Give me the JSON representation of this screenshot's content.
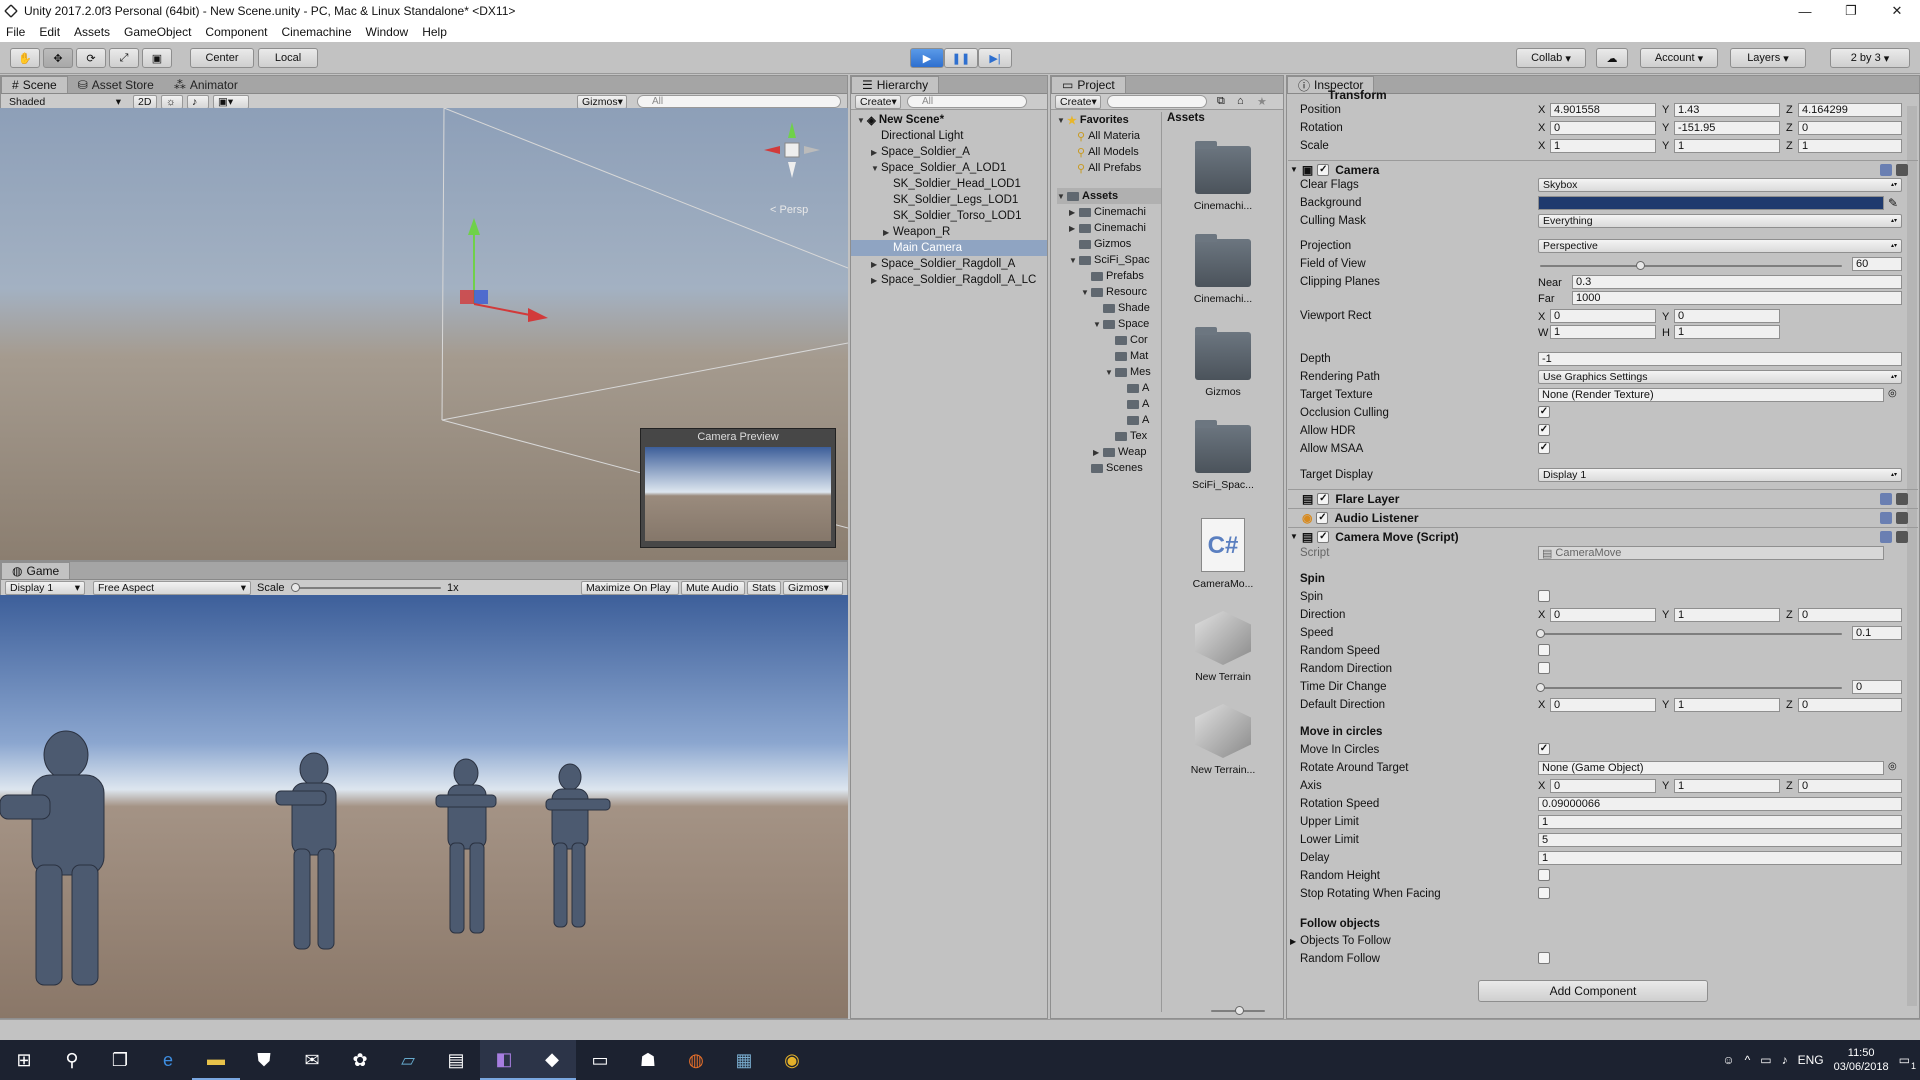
{
  "window": {
    "title": "Unity 2017.2.0f3 Personal (64bit) - New Scene.unity - PC, Mac & Linux Standalone* <DX11>",
    "controls": [
      "—",
      "❐",
      "✕"
    ]
  },
  "menu": [
    "File",
    "Edit",
    "Assets",
    "GameObject",
    "Component",
    "Cinemachine",
    "Window",
    "Help"
  ],
  "toolbar": {
    "pivot": "Center",
    "space": "Local",
    "collab": "Collab",
    "account": "Account",
    "layers": "Layers",
    "layout": "2 by 3"
  },
  "scene": {
    "tabs": [
      "Scene",
      "Asset Store",
      "Animator"
    ],
    "shading": "Shaded",
    "mode2d": "2D",
    "gizmos": "Gizmos",
    "search_placeholder": "All",
    "persp_label": "< Persp",
    "preview_title": "Camera Preview"
  },
  "game": {
    "tab": "Game",
    "display": "Display 1",
    "aspect": "Free Aspect",
    "scale_label": "Scale",
    "scale_value": "1x",
    "buttons": [
      "Maximize On Play",
      "Mute Audio",
      "Stats",
      "Gizmos"
    ]
  },
  "hierarchy": {
    "tab": "Hierarchy",
    "create": "Create",
    "search_placeholder": "All",
    "scene_name": "New Scene*",
    "items": [
      {
        "label": "Directional Light",
        "indent": 1,
        "arrow": ""
      },
      {
        "label": "Space_Soldier_A",
        "indent": 1,
        "arrow": "▶"
      },
      {
        "label": "Space_Soldier_A_LOD1",
        "indent": 1,
        "arrow": "▼"
      },
      {
        "label": "SK_Soldier_Head_LOD1",
        "indent": 2,
        "arrow": ""
      },
      {
        "label": "SK_Soldier_Legs_LOD1",
        "indent": 2,
        "arrow": ""
      },
      {
        "label": "SK_Soldier_Torso_LOD1",
        "indent": 2,
        "arrow": ""
      },
      {
        "label": "Weapon_R",
        "indent": 2,
        "arrow": "▶"
      },
      {
        "label": "Main Camera",
        "indent": 2,
        "arrow": "",
        "selected": true
      },
      {
        "label": "Space_Soldier_Ragdoll_A",
        "indent": 1,
        "arrow": "▶"
      },
      {
        "label": "Space_Soldier_Ragdoll_A_LC",
        "indent": 1,
        "arrow": "▶"
      }
    ]
  },
  "project": {
    "tab": "Project",
    "create": "Create",
    "favorites_label": "Favorites",
    "favorites": [
      "All Materia",
      "All Models",
      "All Prefabs"
    ],
    "assets_label": "Assets",
    "tree": [
      {
        "label": "Cinemachi",
        "indent": 1,
        "arrow": "▶"
      },
      {
        "label": "Cinemachi",
        "indent": 1,
        "arrow": "▶"
      },
      {
        "label": "Gizmos",
        "indent": 1,
        "arrow": ""
      },
      {
        "label": "SciFi_Spac",
        "indent": 1,
        "arrow": "▼"
      },
      {
        "label": "Prefabs",
        "indent": 2,
        "arrow": ""
      },
      {
        "label": "Resourc",
        "indent": 2,
        "arrow": "▼"
      },
      {
        "label": "Shade",
        "indent": 3,
        "arrow": ""
      },
      {
        "label": "Space",
        "indent": 3,
        "arrow": "▼"
      },
      {
        "label": "Cor",
        "indent": 4,
        "arrow": ""
      },
      {
        "label": "Mat",
        "indent": 4,
        "arrow": ""
      },
      {
        "label": "Mes",
        "indent": 4,
        "arrow": "▼"
      },
      {
        "label": "A",
        "indent": 5,
        "arrow": ""
      },
      {
        "label": "A",
        "indent": 5,
        "arrow": ""
      },
      {
        "label": "A",
        "indent": 5,
        "arrow": ""
      },
      {
        "label": "Tex",
        "indent": 4,
        "arrow": ""
      },
      {
        "label": "Weap",
        "indent": 3,
        "arrow": "▶"
      },
      {
        "label": "Scenes",
        "indent": 2,
        "arrow": ""
      }
    ],
    "grid_header": "Assets",
    "grid": [
      {
        "label": "Cinemachi...",
        "kind": "folder"
      },
      {
        "label": "Cinemachi...",
        "kind": "folder"
      },
      {
        "label": "Gizmos",
        "kind": "folder"
      },
      {
        "label": "SciFi_Spac...",
        "kind": "folder"
      },
      {
        "label": "CameraMo...",
        "kind": "script"
      },
      {
        "label": "New Terrain",
        "kind": "terrain"
      },
      {
        "label": "New Terrain...",
        "kind": "terrain"
      }
    ]
  },
  "inspector": {
    "tab": "Inspector",
    "transform": {
      "title": "Transform",
      "position": {
        "label": "Position",
        "x": "4.901558",
        "y": "1.43",
        "z": "4.164299"
      },
      "rotation": {
        "label": "Rotation",
        "x": "0",
        "y": "-151.95",
        "z": "0"
      },
      "scale": {
        "label": "Scale",
        "x": "1",
        "y": "1",
        "z": "1"
      }
    },
    "camera": {
      "title": "Camera",
      "clear_flags": {
        "label": "Clear Flags",
        "value": "Skybox"
      },
      "background": {
        "label": "Background",
        "color": "#1f3a6e"
      },
      "culling_mask": {
        "label": "Culling Mask",
        "value": "Everything"
      },
      "projection": {
        "label": "Projection",
        "value": "Perspective"
      },
      "fov": {
        "label": "Field of View",
        "value": "60",
        "fraction": 0.33
      },
      "clipping": {
        "label": "Clipping Planes",
        "near_label": "Near",
        "near": "0.3",
        "far_label": "Far",
        "far": "1000"
      },
      "viewport": {
        "label": "Viewport Rect",
        "x": "0",
        "y": "0",
        "w": "1",
        "h": "1"
      },
      "depth": {
        "label": "Depth",
        "value": "-1"
      },
      "rendering_path": {
        "label": "Rendering Path",
        "value": "Use Graphics Settings"
      },
      "target_texture": {
        "label": "Target Texture",
        "value": "None (Render Texture)"
      },
      "occlusion": {
        "label": "Occlusion Culling",
        "checked": true
      },
      "hdr": {
        "label": "Allow HDR",
        "checked": true
      },
      "msaa": {
        "label": "Allow MSAA",
        "checked": true
      },
      "target_display": {
        "label": "Target Display",
        "value": "Display 1"
      }
    },
    "flare_layer": "Flare Layer",
    "audio_listener": "Audio Listener",
    "camera_move": {
      "title": "Camera Move (Script)",
      "script": {
        "label": "Script",
        "value": "CameraMove"
      },
      "spin_section": "Spin",
      "spin": {
        "label": "Spin",
        "checked": false
      },
      "direction": {
        "label": "Direction",
        "x": "0",
        "y": "1",
        "z": "0"
      },
      "speed": {
        "label": "Speed",
        "value": "0.1",
        "fraction": 0.0
      },
      "random_speed": {
        "label": "Random Speed",
        "checked": false
      },
      "random_direction": {
        "label": "Random Direction",
        "checked": false
      },
      "time_dir_change": {
        "label": "Time Dir Change",
        "value": "0",
        "fraction": 0.0
      },
      "default_direction": {
        "label": "Default Direction",
        "x": "0",
        "y": "1",
        "z": "0"
      },
      "circles_section": "Move in circles",
      "move_in_circles": {
        "label": "Move In Circles",
        "checked": true
      },
      "rotate_target": {
        "label": "Rotate Around Target",
        "value": "None (Game Object)"
      },
      "axis": {
        "label": "Axis",
        "x": "0",
        "y": "1",
        "z": "0"
      },
      "rotation_speed": {
        "label": "Rotation Speed",
        "value": "0.09000066"
      },
      "upper_limit": {
        "label": "Upper Limit",
        "value": "1"
      },
      "lower_limit": {
        "label": "Lower Limit",
        "value": "5"
      },
      "delay": {
        "label": "Delay",
        "value": "1"
      },
      "random_height": {
        "label": "Random Height",
        "checked": false
      },
      "stop_rotating": {
        "label": "Stop Rotating When Facing",
        "checked": false
      },
      "follow_section": "Follow objects",
      "objects_to_follow": "Objects To Follow",
      "random_follow": {
        "label": "Random Follow",
        "checked": false
      }
    },
    "add_component": "Add Component"
  },
  "taskbar": {
    "lang": "ENG",
    "time": "11:50",
    "date": "03/06/2018",
    "notification_count": "1"
  },
  "colors": {
    "accent": "#3b78d6",
    "selection": "#8fa4c2",
    "taskbar": "#1c2230"
  }
}
